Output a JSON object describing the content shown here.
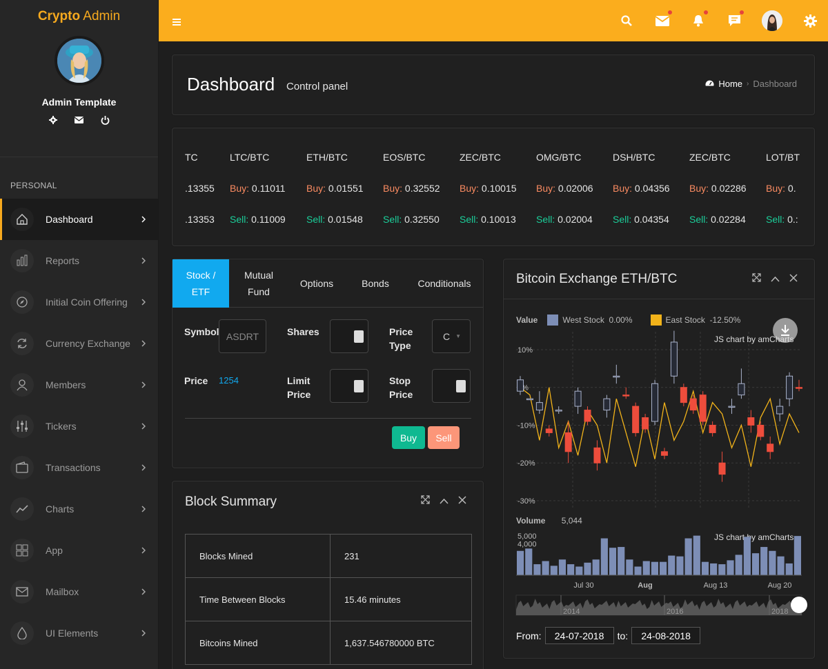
{
  "brand": {
    "part1": "Crypto",
    "part2": " Admin"
  },
  "profile": {
    "name": "Admin Template"
  },
  "sidebar": {
    "section": "PERSONAL",
    "items": [
      {
        "label": "Dashboard",
        "icon": "home-icon"
      },
      {
        "label": "Reports",
        "icon": "bar-chart-icon"
      },
      {
        "label": "Initial Coin Offering",
        "icon": "compass-icon"
      },
      {
        "label": "Currency Exchange",
        "icon": "refresh-icon"
      },
      {
        "label": "Members",
        "icon": "users-icon"
      },
      {
        "label": "Tickers",
        "icon": "sliders-icon"
      },
      {
        "label": "Transactions",
        "icon": "wallet-icon"
      },
      {
        "label": "Charts",
        "icon": "trend-icon"
      },
      {
        "label": "App",
        "icon": "grid-icon"
      },
      {
        "label": "Mailbox",
        "icon": "mail-icon"
      },
      {
        "label": "UI Elements",
        "icon": "drop-icon"
      }
    ]
  },
  "page": {
    "title": "Dashboard",
    "subtitle": "Control panel",
    "crumb_home": "Home",
    "crumb_current": "Dashboard"
  },
  "ticker": [
    {
      "pair": "TC",
      "buy_label": "",
      "buy": ".13355",
      "sell_label": "",
      "sell": ".13353"
    },
    {
      "pair": "LTC/BTC",
      "buy_label": "Buy:",
      "buy": "0.11011",
      "sell_label": "Sell:",
      "sell": "0.11009"
    },
    {
      "pair": "ETH/BTC",
      "buy_label": "Buy:",
      "buy": "0.01551",
      "sell_label": "Sell:",
      "sell": "0.01548"
    },
    {
      "pair": "EOS/BTC",
      "buy_label": "Buy:",
      "buy": "0.32552",
      "sell_label": "Sell:",
      "sell": "0.32550"
    },
    {
      "pair": "ZEC/BTC",
      "buy_label": "Buy:",
      "buy": "0.10015",
      "sell_label": "Sell:",
      "sell": "0.10013"
    },
    {
      "pair": "OMG/BTC",
      "buy_label": "Buy:",
      "buy": "0.02006",
      "sell_label": "Sell:",
      "sell": "0.02004"
    },
    {
      "pair": "DSH/BTC",
      "buy_label": "Buy:",
      "buy": "0.04356",
      "sell_label": "Sell:",
      "sell": "0.04354"
    },
    {
      "pair": "ZEC/BTC",
      "buy_label": "Buy:",
      "buy": "0.02286",
      "sell_label": "Sell:",
      "sell": "0.02284"
    },
    {
      "pair": "LOT/BT",
      "buy_label": "Buy:",
      "buy": "0.",
      "sell_label": "Sell:",
      "sell": "0.:"
    }
  ],
  "trade": {
    "tabs": [
      "Stock / ETF",
      "Mutual Fund",
      "Options",
      "Bonds",
      "Conditionals"
    ],
    "tab_lines": [
      [
        "Stock /",
        "ETF"
      ],
      [
        "Mutual",
        "Fund"
      ],
      [
        "Options"
      ],
      [
        "Bonds"
      ],
      [
        "Conditionals"
      ]
    ],
    "symbol_label": "Symbol",
    "symbol_value": "ASDRT",
    "shares_label": "Shares",
    "price_type_label": [
      "Price",
      "Type"
    ],
    "price_type_value": "C",
    "price_label": "Price",
    "price_value": "1254",
    "limit_label": [
      "Limit",
      "Price"
    ],
    "stop_label": [
      "Stop",
      "Price"
    ],
    "buy_btn": "Buy",
    "sell_btn": "Sell"
  },
  "block": {
    "title": "Block Summary",
    "rows": [
      {
        "label": "Blocks Mined",
        "value": "231"
      },
      {
        "label": "Time Between Blocks",
        "value": "15.46 minutes"
      },
      {
        "label": "Bitcoins Mined",
        "value": "1,637.546780000 BTC"
      }
    ]
  },
  "btc": {
    "title": "Bitcoin Exchange ETH/BTC",
    "value_label": "Value",
    "legend": [
      {
        "name": "West Stock",
        "value": "0.00%",
        "color": "#7d8eb6"
      },
      {
        "name": "East Stock",
        "value": "-12.50%",
        "color": "#f2b31a"
      }
    ],
    "credit": "JS chart by amCharts",
    "volume_label": "Volume",
    "volume_value": "5,044",
    "from_label": "From:",
    "from_value": "24-07-2018",
    "to_label": "to:",
    "to_value": "24-08-2018"
  },
  "chart_data": {
    "type": "candlestick",
    "y_ticks": [
      "10%",
      "0%",
      "-10%",
      "-20%",
      "-30%"
    ],
    "ylim": [
      -30,
      10
    ],
    "west_candles": [
      {
        "o": 2,
        "c": -1,
        "h": 3,
        "l": -2,
        "color": "#7d8eb6"
      },
      {
        "o": -3,
        "c": -3,
        "h": -3,
        "l": -3,
        "color": "#7d8eb6"
      },
      {
        "o": -6,
        "c": -4,
        "h": -1,
        "l": -7,
        "color": "#7d8eb6"
      },
      {
        "o": -12,
        "c": -11,
        "h": -10,
        "l": -13,
        "color": "#ee4d3c"
      },
      {
        "o": -6,
        "c": -6,
        "h": -5,
        "l": -7,
        "color": "#7d8eb6"
      },
      {
        "o": -12,
        "c": -17,
        "h": -9,
        "l": -20,
        "color": "#ee4d3c"
      },
      {
        "o": -5,
        "c": -1,
        "h": 0,
        "l": -7,
        "color": "#7d8eb6"
      },
      {
        "o": -6,
        "c": -9,
        "h": -5,
        "l": -10,
        "color": "#ee4d3c"
      },
      {
        "o": -16,
        "c": -20,
        "h": -14,
        "l": -22,
        "color": "#ee4d3c"
      },
      {
        "o": -6,
        "c": -3,
        "h": -2,
        "l": -8,
        "color": "#7d8eb6"
      },
      {
        "o": 3,
        "c": 3,
        "h": 6,
        "l": 1,
        "color": "#7d8eb6"
      },
      {
        "o": -2,
        "c": -2,
        "h": 0,
        "l": -3,
        "color": "#ee4d3c"
      },
      {
        "o": -5,
        "c": -12,
        "h": -4,
        "l": -13,
        "color": "#ee4d3c"
      },
      {
        "o": -8,
        "c": -11,
        "h": -7,
        "l": -12,
        "color": "#ee4d3c"
      },
      {
        "o": -9,
        "c": 1,
        "h": 2,
        "l": -10,
        "color": "#7d8eb6"
      },
      {
        "o": -17,
        "c": -18,
        "h": -16,
        "l": -19,
        "color": "#ee4d3c"
      },
      {
        "o": 3,
        "c": 12,
        "h": 15,
        "l": 1,
        "color": "#7d8eb6"
      },
      {
        "o": 0,
        "c": -4,
        "h": 1,
        "l": -5,
        "color": "#ee4d3c"
      },
      {
        "o": -3,
        "c": -6,
        "h": -2,
        "l": -7,
        "color": "#ee4d3c"
      },
      {
        "o": -2,
        "c": -9,
        "h": -1,
        "l": -10,
        "color": "#ee4d3c"
      },
      {
        "o": -10,
        "c": -12,
        "h": -9,
        "l": -13,
        "color": "#ee4d3c"
      },
      {
        "o": -20,
        "c": -23,
        "h": -17,
        "l": -25,
        "color": "#ee4d3c"
      },
      {
        "o": -5,
        "c": -5,
        "h": -3,
        "l": -7,
        "color": "#7d8eb6"
      },
      {
        "o": -2,
        "c": 1,
        "h": 5,
        "l": -3,
        "color": "#7d8eb6"
      },
      {
        "o": -8,
        "c": -10,
        "h": -6,
        "l": -12,
        "color": "#ee4d3c"
      },
      {
        "o": -10,
        "c": -13,
        "h": -9,
        "l": -14,
        "color": "#ee4d3c"
      },
      {
        "o": -15,
        "c": -17,
        "h": -13,
        "l": -19,
        "color": "#ee4d3c"
      },
      {
        "o": -7,
        "c": -5,
        "h": -3,
        "l": -9,
        "color": "#7d8eb6"
      },
      {
        "o": -3,
        "c": 3,
        "h": 4,
        "l": -5,
        "color": "#7d8eb6"
      },
      {
        "o": 0,
        "c": 0,
        "h": 2,
        "l": -1,
        "color": "#ee4d3c"
      }
    ],
    "east_line": [
      0,
      -2,
      -14,
      0,
      -16,
      -9,
      -18,
      -6,
      -10,
      -20,
      -3,
      -12,
      -21,
      -8,
      -19,
      -4,
      -14,
      -9,
      -1,
      -12,
      -4,
      -7,
      -16,
      -10,
      -21,
      -8,
      -3,
      -15,
      -7,
      -12
    ],
    "volume_ticks": [
      "5,000",
      "4,000"
    ],
    "volume": [
      3100,
      3400,
      1400,
      1800,
      1200,
      2000,
      1400,
      1100,
      1600,
      2000,
      4700,
      3500,
      3600,
      2000,
      1100,
      1800,
      1700,
      1700,
      2500,
      2400,
      4700,
      5044,
      1700,
      1500,
      1400,
      1900,
      2600,
      4900,
      2800,
      3600,
      3100,
      2400,
      1500,
      5000
    ],
    "x_labels": [
      "Jul 30",
      "Aug",
      "Aug 13",
      "Aug 20"
    ],
    "nav_labels": [
      "2014",
      "2016",
      "2018"
    ]
  }
}
